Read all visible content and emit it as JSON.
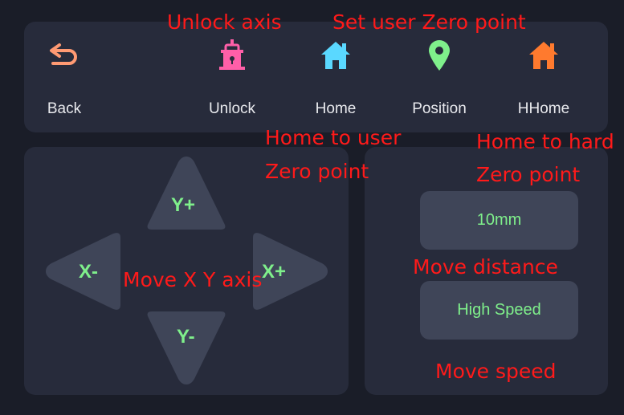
{
  "toolbar": {
    "back": "Back",
    "unlock": "Unlock",
    "home": "Home",
    "position": "Position",
    "hhome": "HHome"
  },
  "jog": {
    "y_plus": "Y+",
    "y_minus": "Y-",
    "x_minus": "X-",
    "x_plus": "X+"
  },
  "settings": {
    "distance": "10mm",
    "speed": "High Speed"
  },
  "annotations": {
    "unlock_axis": "Unlock axis",
    "set_zero": "Set user Zero point",
    "home_user_1": "Home to user",
    "home_user_2": "Zero point",
    "home_hard_1": "Home to hard",
    "home_hard_2": "Zero point",
    "move_xy": "Move X Y axis",
    "move_distance": "Move distance",
    "move_speed": "Move speed"
  },
  "colors": {
    "background": "#1a1d28",
    "panel": "#272b3b",
    "button": "#3f4558",
    "accent_green": "#7ff08b",
    "back_icon": "#ff9a73",
    "unlock_icon": "#ff5fa8",
    "home_icon": "#5ad8ff",
    "position_icon": "#7ff08b",
    "hhome_icon": "#ff7a2e",
    "annotation": "#ff1a1a"
  },
  "icons": {
    "back": "back-arrow-icon",
    "unlock": "padlock-icon",
    "home": "home-icon",
    "position": "location-pin-icon",
    "hhome": "home-icon"
  }
}
